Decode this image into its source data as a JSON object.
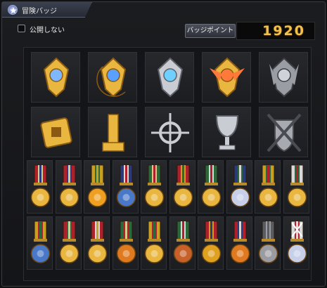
{
  "window": {
    "title": "冒険バッジ",
    "title_icon": "star-badge-icon"
  },
  "options": {
    "hide_label": "公開しない",
    "hide_checked": false
  },
  "points": {
    "label": "バッジポイント",
    "value": "1920"
  },
  "colors": {
    "accent_gold": "#f3c04a",
    "panel_bg": "#141518"
  },
  "large_badges": [
    {
      "name": "sun-crest-badge-icon"
    },
    {
      "name": "crescent-moon-flame-badge-icon"
    },
    {
      "name": "silver-tiara-badge-icon"
    },
    {
      "name": "golden-winged-crest-badge-icon"
    },
    {
      "name": "dark-horned-crest-badge-icon"
    },
    {
      "name": "golden-cube-badge-icon"
    },
    {
      "name": "golden-tower-badge-icon"
    },
    {
      "name": "silver-compass-star-badge-icon"
    },
    {
      "name": "silver-trophy-badge-icon"
    },
    {
      "name": "crossed-swords-shield-badge-icon"
    }
  ],
  "medals": [
    {
      "name": "ring-medal-icon"
    },
    {
      "name": "globe-medal-icon"
    },
    {
      "name": "flame-medal-icon"
    },
    {
      "name": "lion-mask-medal-icon"
    },
    {
      "name": "cone-medal-icon"
    },
    {
      "name": "crystal-medal-icon"
    },
    {
      "name": "teapot-medal-icon"
    },
    {
      "name": "spirit-medal-icon"
    },
    {
      "name": "dragon-medal-icon"
    },
    {
      "name": "bird-medal-icon"
    },
    {
      "name": "crystal-ball-medal-icon"
    },
    {
      "name": "phoenix-medal-icon"
    },
    {
      "name": "compass-medal-icon"
    },
    {
      "name": "boot-medal-icon"
    },
    {
      "name": "gauntlet-medal-icon"
    },
    {
      "name": "claw-medal-icon"
    },
    {
      "name": "orb-medal-icon"
    },
    {
      "name": "chick-medal-icon"
    },
    {
      "name": "lion-helm-medal-icon"
    },
    {
      "name": "doll-medal-icon"
    }
  ]
}
